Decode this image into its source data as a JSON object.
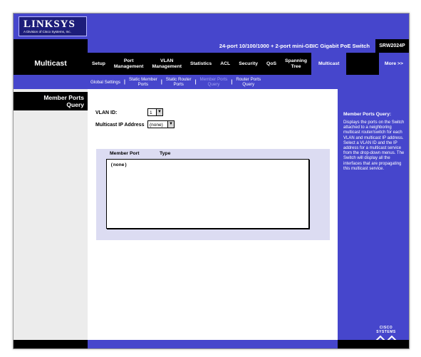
{
  "brand": {
    "logo": "LINKSYS",
    "logo_sub": "A Division of Cisco Systems, Inc."
  },
  "titlebar": {
    "product": "24-port 10/100/1000 + 2-port mini-GBIC Gigabit PoE Switch",
    "model": "SRW2024P"
  },
  "nav": {
    "section": "Multicast",
    "tabs": [
      {
        "label": "Setup"
      },
      {
        "label": "Port\nManagement"
      },
      {
        "label": "VLAN\nManagement"
      },
      {
        "label": "Statistics"
      },
      {
        "label": "ACL"
      },
      {
        "label": "Security"
      },
      {
        "label": "QoS"
      },
      {
        "label": "Spanning\nTree"
      },
      {
        "label": "Multicast"
      },
      {
        "label": "More >>"
      }
    ]
  },
  "subtabs": [
    {
      "label": "Global Settings"
    },
    {
      "label": "Static Member\nPorts"
    },
    {
      "label": "Static Router\nPorts"
    },
    {
      "label": "Member Ports\nQuery"
    },
    {
      "label": "Router Ports\nQuery"
    }
  ],
  "page": {
    "title": "Member Ports\nQuery",
    "vlan_label": "VLAN ID:",
    "vlan_value": "1",
    "ip_label": "Multicast IP Address",
    "ip_value": "(none)",
    "col_member_port": "Member Port",
    "col_type": "Type",
    "list_item": "(none)"
  },
  "help": {
    "title": "Member Ports Query:",
    "text": "Displays the ports on the Switch attached to a neighboring multicast router/switch for each VLAN and multicast IP address. Select a VLAN ID and the IP address for a multicast service from the drop-down menus. The Switch will display all the interfaces that are propagating this multicast service.",
    "cisco": "CISCO SYSTEMS"
  },
  "colors": {
    "accent": "#4646cc",
    "panel": "#dcdcf2",
    "leftcol": "#ececec",
    "bar": "#000000"
  }
}
